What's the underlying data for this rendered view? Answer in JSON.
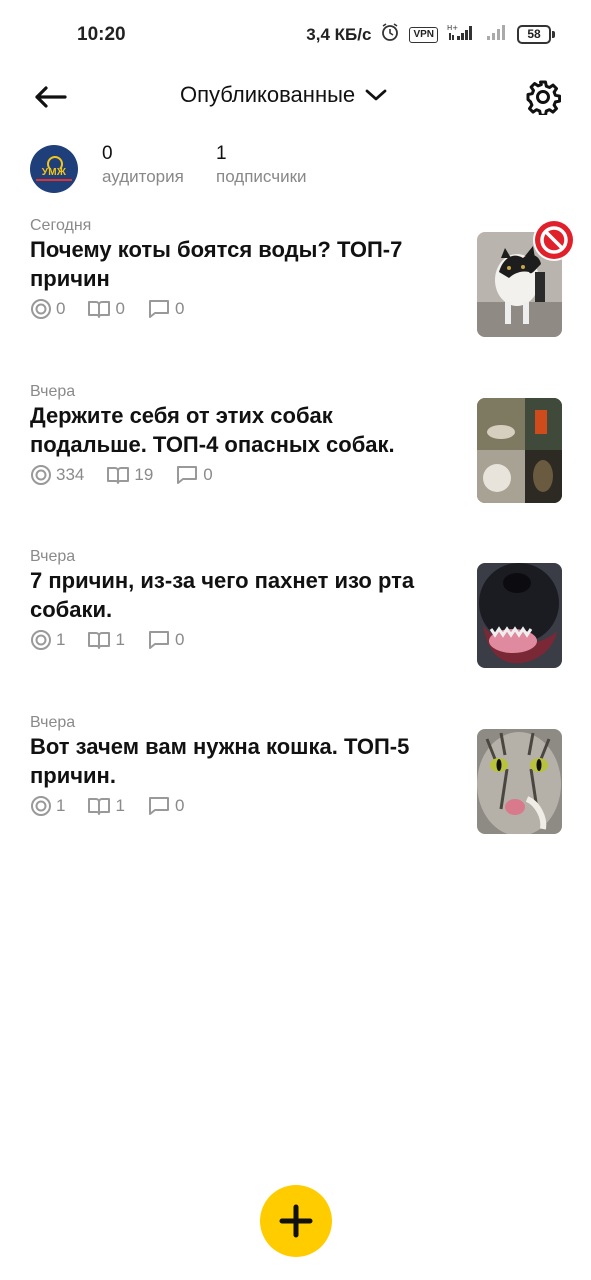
{
  "status_bar": {
    "time": "10:20",
    "speed": "3,4 КБ/с",
    "vpn": "VPN",
    "battery": "58"
  },
  "header": {
    "title": "Опубликованные"
  },
  "profile": {
    "audience_value": "0",
    "audience_label": "аудитория",
    "subscribers_value": "1",
    "subscribers_label": "подписчики",
    "avatar_text": "УМЖ"
  },
  "articles": [
    {
      "date": "Сегодня",
      "title": "Почему коты боятся воды? ТОП-7 причин",
      "views": "0",
      "reads": "0",
      "comments": "0",
      "blocked": true
    },
    {
      "date": "Вчера",
      "title": "Держите себя от этих собак подальше. ТОП-4 опасных собак.",
      "views": "334",
      "reads": "19",
      "comments": "0",
      "blocked": false
    },
    {
      "date": "Вчера",
      "title": "7 причин, из-за чего пахнет изо рта собаки.",
      "views": "1",
      "reads": "1",
      "comments": "0",
      "blocked": false
    },
    {
      "date": "Вчера",
      "title": "Вот зачем вам нужна кошка. ТОП-5 причин.",
      "views": "1",
      "reads": "1",
      "comments": "0",
      "blocked": false
    }
  ],
  "colors": {
    "accent": "#ffcc00",
    "blocked": "#e0202a",
    "muted_text": "#8a8a8a"
  }
}
